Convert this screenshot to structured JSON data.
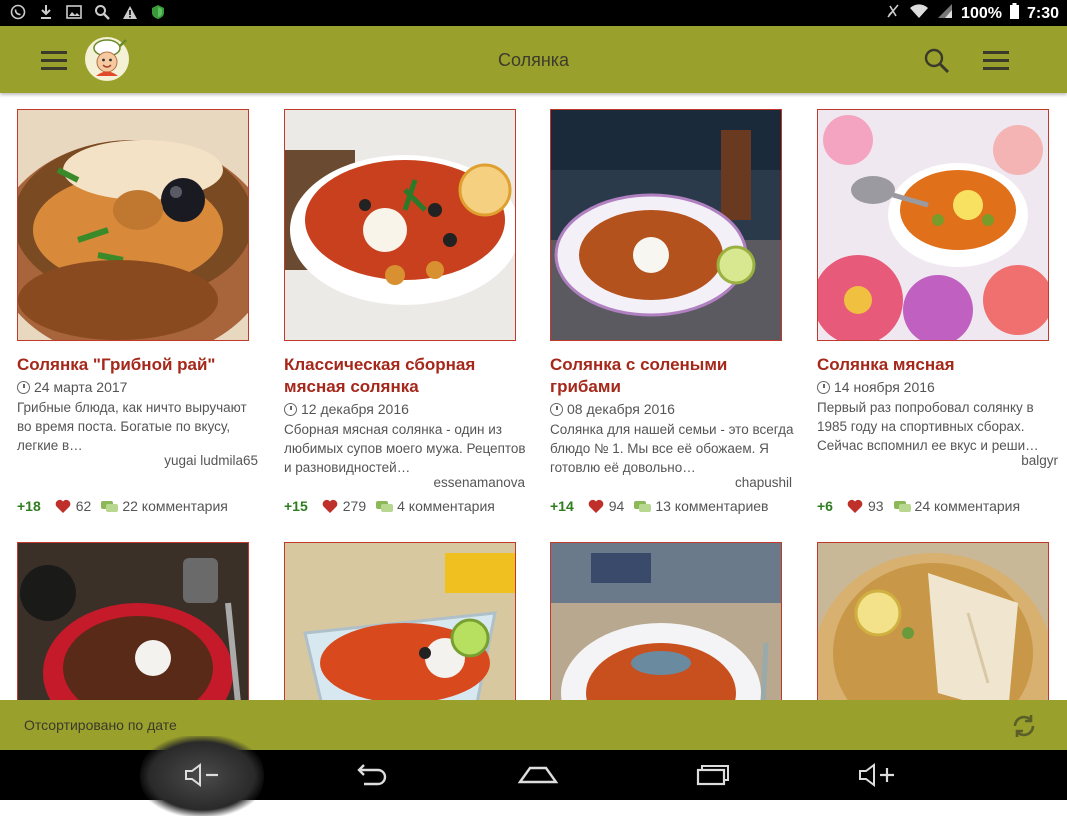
{
  "status_bar": {
    "battery": "100%",
    "time": "7:30",
    "left_icons": [
      "viber-icon",
      "download-icon",
      "image-icon",
      "search-icon",
      "warning-icon",
      "shield-icon"
    ]
  },
  "app_bar": {
    "title": "Солянка",
    "color": "#9aa02c"
  },
  "recipes": [
    {
      "title": "Солянка \"Грибной рай\"",
      "date": "24 марта 2017",
      "description": "Грибные блюда, как ничто выручают во время поста. Богатые по вкусу, легкие в…",
      "author": "yugai ludmila65",
      "score": "+18",
      "likes": "62",
      "comments": "22 комментария"
    },
    {
      "title": "Классическая сборная мясная солянка",
      "date": "12 декабря 2016",
      "description": "Сборная мясная солянка - один из любимых супов моего мужа. Рецептов и разновидностей…",
      "author": "essenamanova",
      "score": "+15",
      "likes": "279",
      "comments": "4 комментария"
    },
    {
      "title": "Солянка с солеными грибами",
      "date": "08 декабря 2016",
      "description": "Солянка для нашей семьи - это всегда блюдо № 1. Мы все её обожаем. Я готовлю её довольно…",
      "author": "chapushil",
      "score": "+14",
      "likes": "94",
      "comments": "13 комментариев"
    },
    {
      "title": "Солянка мясная",
      "date": "14 ноября 2016",
      "description": "Первый раз попробовал солянку в 1985 году на спортивных сборах. Сейчас вспомнил ее вкус и реши…",
      "author": "balgyr",
      "score": "+6",
      "likes": "93",
      "comments": "24 комментария"
    }
  ],
  "sort_bar": {
    "label": "Отсортировано по дате"
  },
  "colors": {
    "accent": "#9aa02c",
    "title_red": "#a5281b",
    "score_green": "#2e7d1f"
  }
}
